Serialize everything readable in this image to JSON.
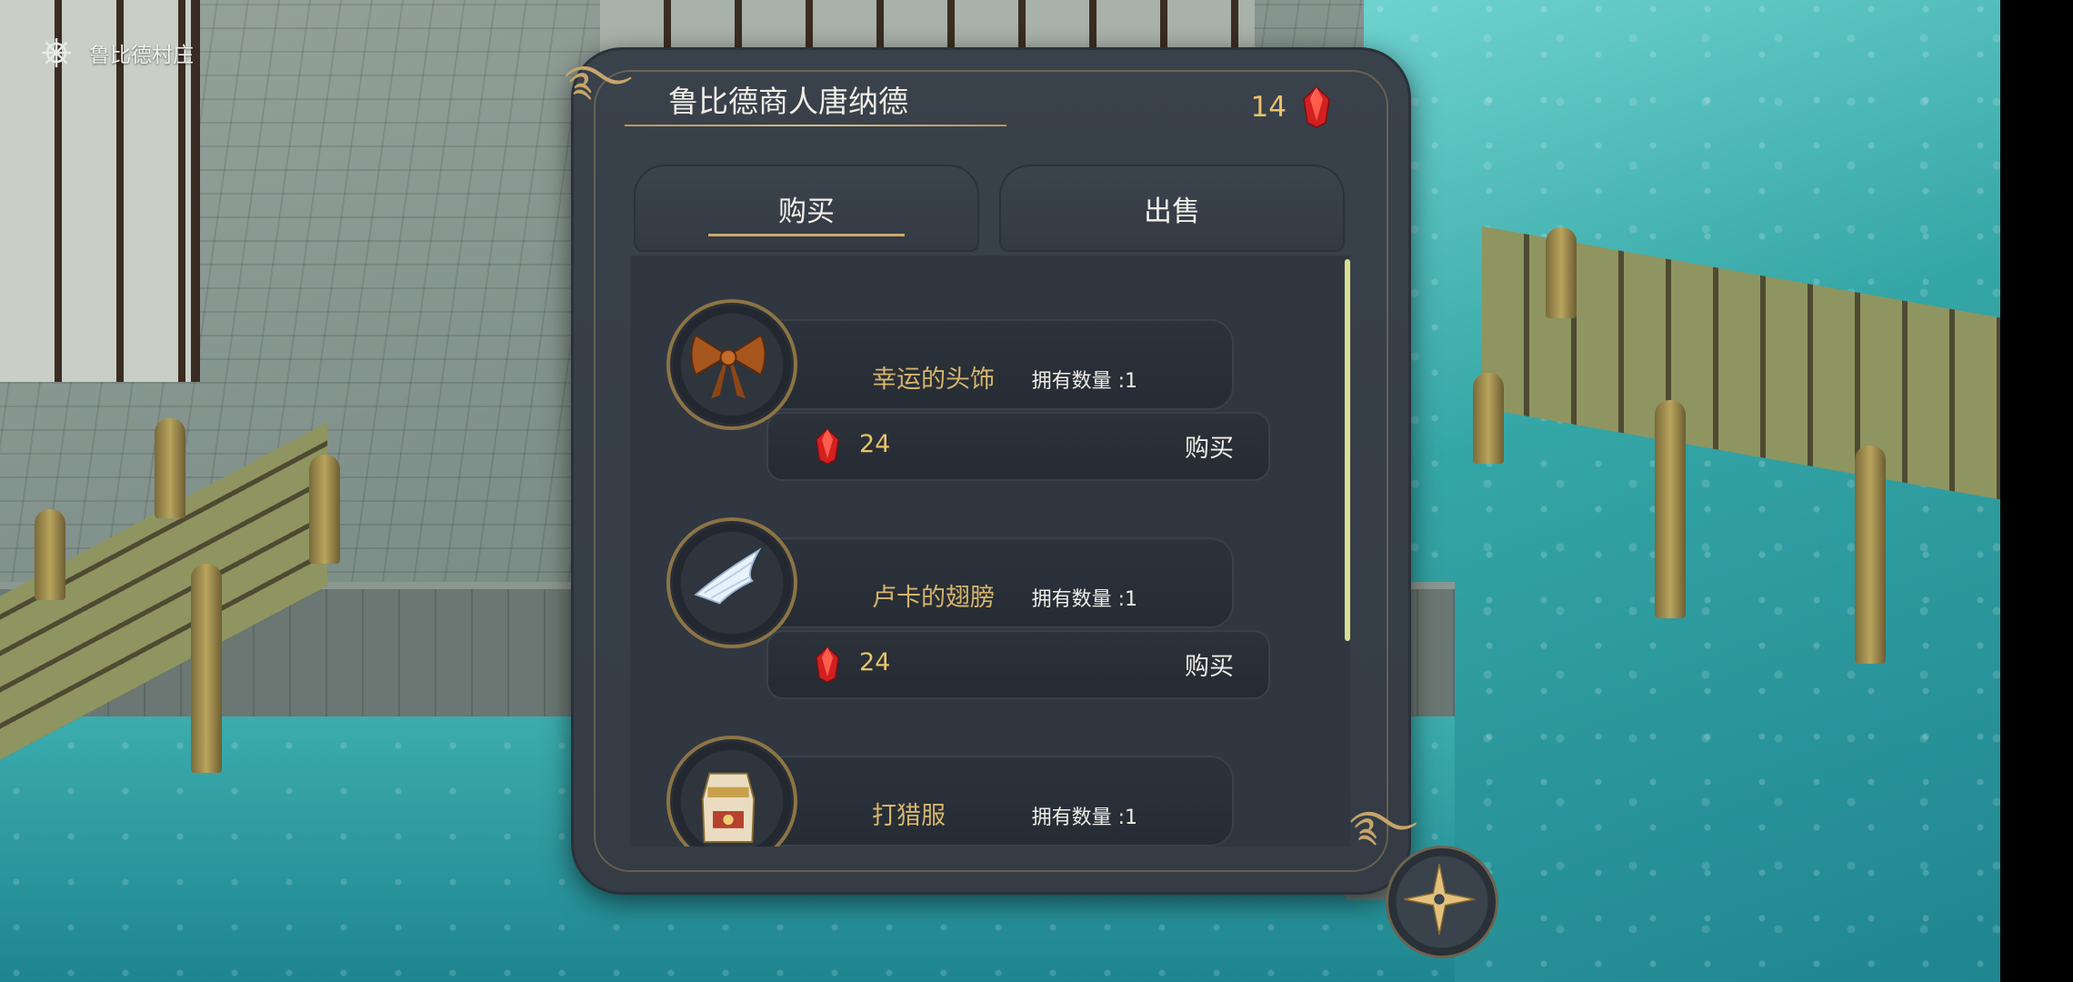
{
  "location": {
    "name": "鲁比德村庄",
    "icon": "ship-wheel-icon"
  },
  "shop": {
    "title": "鲁比德商人唐纳德",
    "currency": {
      "amount": "14",
      "icon": "red-gem-icon"
    },
    "tabs": [
      {
        "label": "购买",
        "selected": true
      },
      {
        "label": "出售",
        "selected": false
      }
    ],
    "items": [
      {
        "name": "幸运的头饰",
        "owned": "拥有数量 :1",
        "price": "24",
        "buy_label": "购买",
        "icon": "bow-icon"
      },
      {
        "name": "卢卡的翅膀",
        "owned": "拥有数量 :1",
        "price": "24",
        "buy_label": "购买",
        "icon": "wing-icon"
      },
      {
        "name": "打猎服",
        "owned": "拥有数量 :1",
        "icon": "hunting-outfit-icon"
      }
    ]
  },
  "colors": {
    "accent_gold": "#cda869",
    "gem_red": "#e0262b",
    "scrollbar": "#d9e08f"
  }
}
